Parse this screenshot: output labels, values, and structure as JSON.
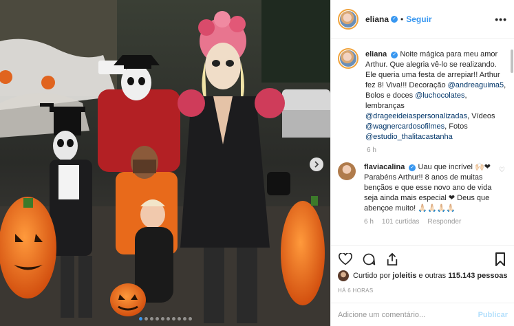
{
  "header": {
    "username": "eliana",
    "follow_label": "Seguir",
    "separator": "•",
    "more_label": "•••"
  },
  "caption": {
    "username": "eliana",
    "parts": [
      "Noite mágica para meu amor Arthur. Que alegria vê-lo se realizando. Ele queria uma festa de arrepiar!! Arthur fez 8! Viva!!! Decoração ",
      "@andreaguima5",
      ", Bolos e doces ",
      "@luchocolates",
      ", lembranças ",
      "@drageeideiaspersonalizadas",
      ", Vídeos ",
      "@wagnercardosofilmes",
      ", Fotos ",
      "@estudio_thalitacastanha"
    ],
    "time": "6 h"
  },
  "comment": {
    "username": "flaviacalina",
    "text": "Uau que incrível 🙌🏻❤ Parabéns Arthur!! 8 anos de muitas bençãos e que esse novo ano de vida seja ainda mais especial ❤ Deus que abençoe muito! 🙏🏻🙏🏻🙏🏻🙏🏻",
    "time": "6 h",
    "likes": "101 curtidas",
    "reply": "Responder"
  },
  "likes": {
    "prefix": "Curtido por",
    "user": "joleitis",
    "middle": "e outras",
    "count": "115.143 pessoas"
  },
  "post_time": "HÁ 6 HORAS",
  "add_comment": {
    "placeholder": "Adicione um comentário...",
    "publish_label": "Publicar"
  },
  "carousel": {
    "total": 10,
    "active": 0
  },
  "colors": {
    "accent": "#3897f0",
    "publish_disabled": "#b2dffc",
    "pumpkin": "#e8631c"
  }
}
